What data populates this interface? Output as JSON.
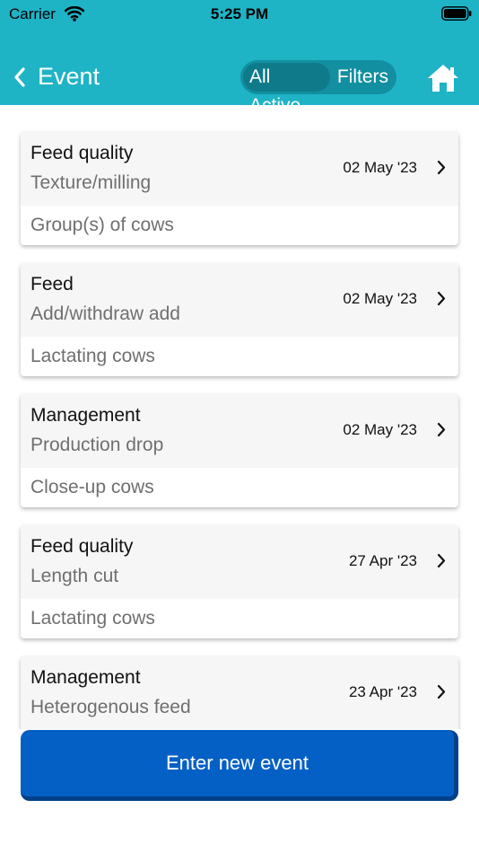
{
  "status_bar": {
    "carrier": "Carrier",
    "time": "5:25 PM"
  },
  "header": {
    "title": "Event",
    "segment": {
      "all_active": "All Active",
      "filters": "Filters"
    },
    "icons": {
      "back": "chevron-left-icon",
      "home": "home-icon"
    },
    "background_color": "#1fb3c6"
  },
  "events": [
    {
      "type": "Feed quality",
      "detail": "Texture/milling",
      "date": "02 May '23",
      "group": "Group(s) of cows"
    },
    {
      "type": "Feed",
      "detail": "Add/withdraw add",
      "date": "02 May '23",
      "group": "Lactating cows"
    },
    {
      "type": "Management",
      "detail": "Production drop",
      "date": "02 May '23",
      "group": "Close-up cows"
    },
    {
      "type": "Feed quality",
      "detail": "Length cut",
      "date": "27 Apr '23",
      "group": "Lactating cows"
    },
    {
      "type": "Management",
      "detail": "Heterogenous feed",
      "date": "23 Apr '23",
      "group": ""
    }
  ],
  "footer": {
    "enter_new_event": "Enter new event",
    "button_color": "#0460c4"
  }
}
